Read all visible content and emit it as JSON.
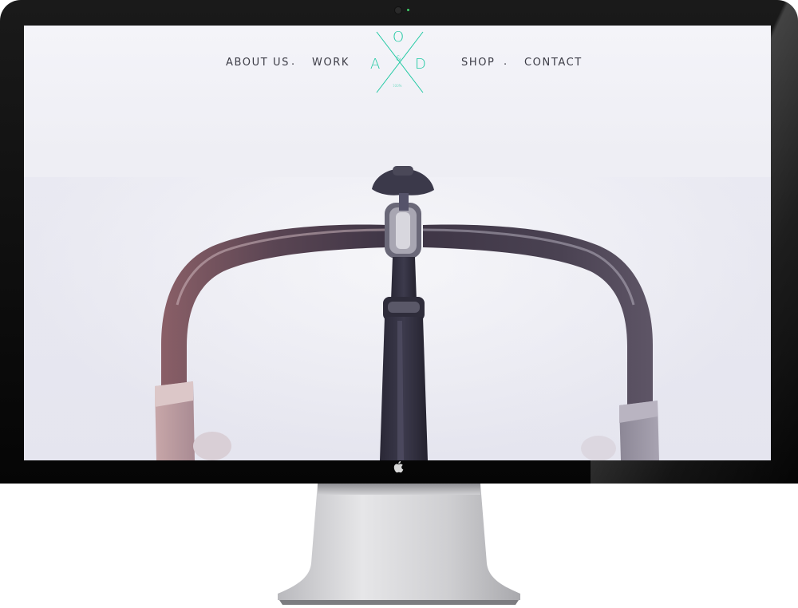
{
  "nav": {
    "items": [
      {
        "label": "ABOUT US"
      },
      {
        "label": "WORK"
      },
      {
        "label": "SHOP"
      },
      {
        "label": "CONTACT"
      }
    ],
    "separator": "."
  },
  "logo": {
    "top_letter": "O",
    "left_letter": "A",
    "right_letter": "D",
    "ampersand": "&",
    "percent": "100%"
  },
  "colors": {
    "accent": "#1fc9a2",
    "nav_text": "#3c3c46",
    "bezel": "#0b0b0b"
  },
  "icons": [
    "apple-logo-icon",
    "camera-icon"
  ]
}
